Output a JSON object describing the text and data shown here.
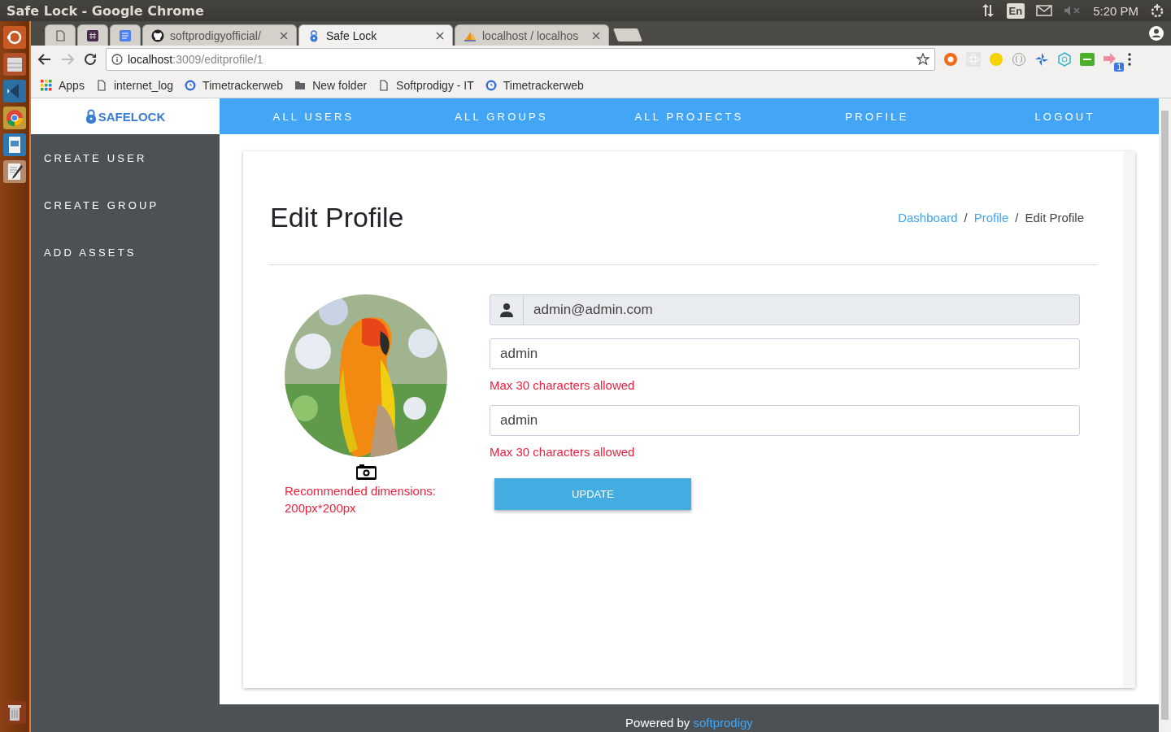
{
  "system_bar": {
    "title": "Safe Lock - Google Chrome",
    "keyboard": "En",
    "time": "5:20 PM"
  },
  "launcher": [
    {
      "kind": "ubuntu"
    },
    {
      "kind": "files"
    },
    {
      "kind": "code"
    },
    {
      "kind": "chrome"
    },
    {
      "kind": "writer"
    },
    {
      "kind": "editor"
    },
    {
      "kind": "trash"
    }
  ],
  "browser": {
    "tabs": [
      {
        "kind": "page",
        "selected": false
      },
      {
        "kind": "hash",
        "selected": false
      },
      {
        "kind": "doc",
        "selected": false
      },
      {
        "kind": "github",
        "label": "softprodigyofficial/",
        "selected": false
      },
      {
        "kind": "lock",
        "label": "Safe Lock",
        "selected": true
      },
      {
        "kind": "pma",
        "label": "localhost / localhos",
        "selected": false
      }
    ],
    "url": {
      "host": "localhost",
      "rest": ":3009/editprofile/1"
    },
    "extension_badge": "1",
    "bookmarks": [
      {
        "kind": "apps",
        "label": "Apps"
      },
      {
        "kind": "page",
        "label": "internet_log"
      },
      {
        "kind": "clock",
        "label": "Timetrackerweb"
      },
      {
        "kind": "folder",
        "label": "New folder"
      },
      {
        "kind": "page",
        "label": "Softprodigy - IT"
      },
      {
        "kind": "clock",
        "label": "Timetrackerweb"
      }
    ]
  },
  "app": {
    "brand": "SAFELOCK",
    "nav": [
      "ALL USERS",
      "ALL GROUPS",
      "ALL PROJECTS",
      "PROFILE",
      "LOGOUT"
    ],
    "sidebar": [
      "CREATE USER",
      "CREATE GROUP",
      "ADD ASSETS"
    ],
    "page_title": "Edit Profile",
    "breadcrumb": [
      {
        "label": "Dashboard",
        "kind": "link",
        "separator": "/"
      },
      {
        "label": "Profile",
        "kind": "link",
        "separator": "/"
      },
      {
        "label": "Edit Profile",
        "kind": "current"
      }
    ],
    "photo": {
      "kind": "picture",
      "hint": "Recommended dimensions: 200px*200px"
    },
    "form": {
      "email": "admin@admin.com",
      "fields": [
        {
          "value": "admin",
          "error": "Max 30 characters allowed"
        },
        {
          "value": "admin",
          "error": "Max 30 characters allowed"
        }
      ],
      "button": "UPDATE"
    },
    "footer": {
      "text": "Powered by",
      "link": "softprodigy"
    }
  }
}
